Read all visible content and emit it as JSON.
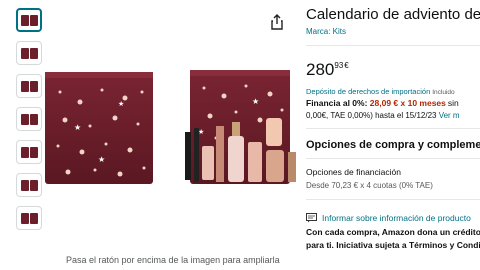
{
  "gallery": {
    "thumbnail_count": 7,
    "caption": "Pasa el ratón por encima de la imagen para ampliarla"
  },
  "product": {
    "title": "Calendario de adviento de",
    "brand": "Marca: Kits",
    "price_whole": "280",
    "price_fraction": "93",
    "currency": "€",
    "import_link": "Depósito de derechos de importación",
    "import_rest": "Incluido",
    "financing_label": "Financia al 0%:",
    "financing_amount": "28,09 € x 10 meses",
    "financing_sin": "sin",
    "financing_line2": "0,00€, TAE 0,00%) hasta el 15/12/23",
    "financing_more": "Ver m"
  },
  "options": {
    "heading": "Opciones de compra y complemen",
    "financing_title": "Opciones de financiación",
    "financing_sub": "Desde 70,23 € x 4 cuotas (0% TAE)",
    "info_link": "Informar sobre información de producto",
    "credit_line1": "Con cada compra, Amazon dona un crédito",
    "credit_line2": "para ti. Iniciativa sujeta a Términos y Condi"
  },
  "colors": {
    "link": "#007185",
    "price_red": "#B12704",
    "box_burgundy": "#6b1f2a"
  }
}
